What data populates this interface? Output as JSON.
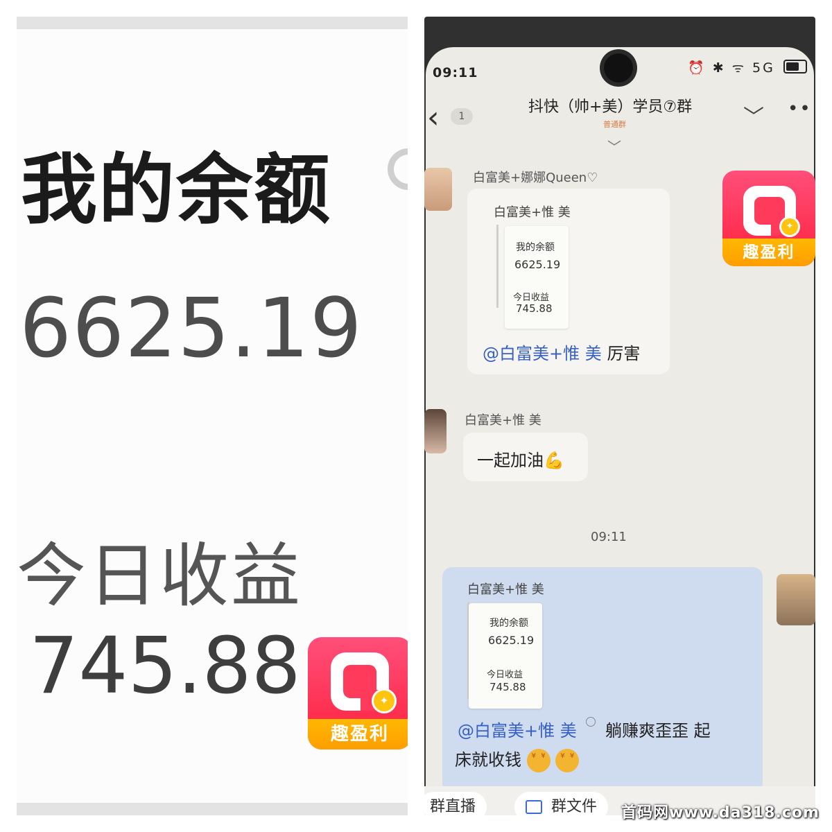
{
  "left": {
    "balance_label": "我的余额",
    "balance_value": "6625.19",
    "income_label": "今日收益",
    "income_value": "745.88",
    "app_logo_text": "趣盈利"
  },
  "phone": {
    "status_time": "09:11",
    "status_icons": "⏰ ✱ ᯤ 5G",
    "back_count": "1",
    "chat_title": "抖快（帅+美）学员⑦群",
    "chat_tag": "普通群",
    "app_logo_text": "趣盈利",
    "messages": [
      {
        "sender": "白富美+娜娜Queen♡",
        "quote_name": "白富美+惟 美",
        "quote_balance_label": "我的余额",
        "quote_balance_value": "6625.19",
        "quote_income_label": "今日收益",
        "quote_income_value": "745.88",
        "mention": "@白富美+惟 美",
        "text": "厉害"
      },
      {
        "sender": "白富美+惟 美",
        "text": "一起加油💪"
      }
    ],
    "time_separator": "09:11",
    "my_message": {
      "quote_name": "白富美+惟 美",
      "quote_balance_label": "我的余额",
      "quote_balance_value": "6625.19",
      "quote_income_label": "今日收益",
      "quote_income_value": "745.88",
      "mention": "@白富美+惟 美",
      "text_line1": "躺赚爽歪歪 起",
      "text_line2": "床就收钱"
    },
    "bottom_chips": [
      "群直播",
      "群文件"
    ]
  },
  "watermark": "首码网www.da318.com",
  "colors": {
    "logo_red": "#ff3a5a",
    "logo_band": "#ffa800",
    "mention_blue": "#3660c6",
    "my_bubble": "#cfdcf0"
  }
}
